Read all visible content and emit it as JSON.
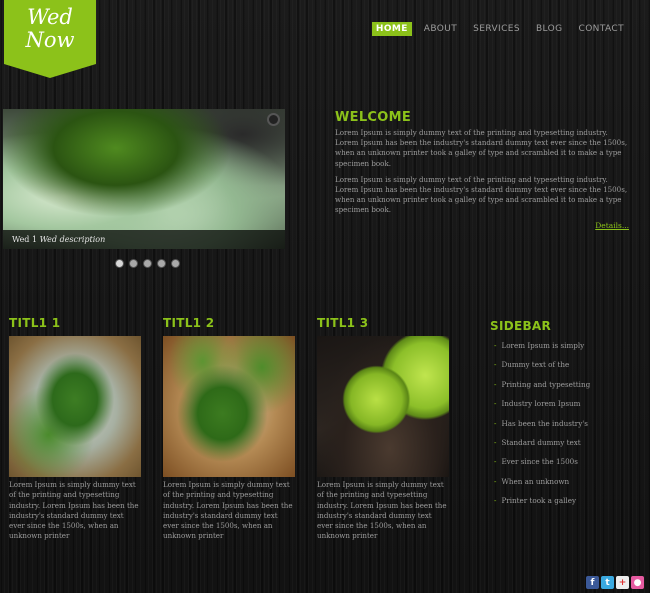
{
  "brand": {
    "line1": "Wed",
    "line2": "Now"
  },
  "nav": {
    "items": [
      "HOME",
      "ABOUT",
      "SERVICES",
      "BLOG",
      "CONTACT"
    ],
    "active": "HOME"
  },
  "slider": {
    "caption_title": "Wed 1",
    "caption_description": "Wed description",
    "dot_count": 5,
    "active_dot": 1
  },
  "welcome": {
    "heading": "WELCOME",
    "paragraph1": "Lorem Ipsum is simply dummy text of the printing and typesetting industry. Lorem Ipsum has been the industry's standard dummy text ever since the 1500s, when an unknown printer took a galley of type and scrambled it to make a type specimen book.",
    "paragraph2": "Lorem Ipsum is simply dummy text of the printing and typesetting industry. Lorem Ipsum has been the industry's standard dummy text ever since the 1500s, when an unknown printer took a galley of type and scrambled it to make a type specimen book.",
    "details_link": "Details..."
  },
  "columns": [
    {
      "title": "TITL1 1",
      "text": "Lorem Ipsum is simply dummy text of the printing and typesetting industry. Lorem Ipsum has been the industry's standard dummy text ever since the 1500s, when an unknown printer"
    },
    {
      "title": "TITL1 2",
      "text": "Lorem Ipsum is simply dummy text of the printing and typesetting industry. Lorem Ipsum has been the industry's standard dummy text ever since the 1500s, when an unknown printer"
    },
    {
      "title": "TITL1 3",
      "text": "Lorem Ipsum is simply dummy text of the printing and typesetting industry. Lorem Ipsum has been the industry's standard dummy text ever since the 1500s, when an unknown printer"
    }
  ],
  "sidebar": {
    "title": "SIDEBAR",
    "items": [
      "Lorem Ipsum is simply",
      "Dummy text of the",
      "Printing and typesetting",
      "Industry lorem Ipsum",
      "Has been the industry's",
      "Standard dummy text",
      "Ever since the 1500s",
      "When an unknown",
      "Printer took a galley"
    ]
  },
  "social": {
    "icons": [
      "facebook-icon",
      "twitter-icon",
      "google-plus-icon",
      "flickr-icon"
    ]
  },
  "colors": {
    "accent": "#8cc21a",
    "background": "#141414",
    "text": "#9c9c9c"
  }
}
